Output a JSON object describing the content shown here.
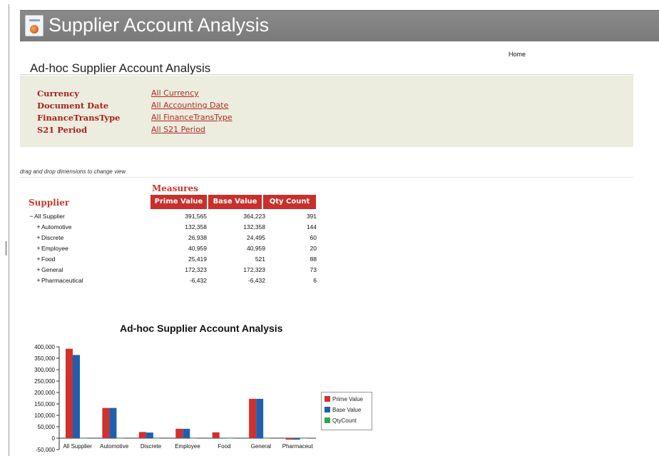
{
  "app": {
    "title": "Supplier Account Analysis"
  },
  "nav": {
    "home_label": "Home"
  },
  "page": {
    "heading": "Ad-hoc Supplier Account Analysis"
  },
  "filters": [
    {
      "label": "Currency",
      "value": "All Currency"
    },
    {
      "label": "Document Date",
      "value": "All Accounting Date"
    },
    {
      "label": "FinanceTransType",
      "value": "All FinanceTransType"
    },
    {
      "label": "S21 Period",
      "value": "All S21 Period"
    }
  ],
  "hint_text": "drag and drop dimensions to change view",
  "grid": {
    "measures_label": "Measures",
    "dimension_label": "Supplier",
    "columns": [
      "Prime Value",
      "Base Value",
      "Qty Count"
    ],
    "rows": [
      {
        "expander": "−",
        "label": "All Supplier",
        "level": 0,
        "values": [
          "391,565",
          "364,223",
          "391"
        ]
      },
      {
        "expander": "+",
        "label": "Automotive",
        "level": 1,
        "values": [
          "132,358",
          "132,358",
          "144"
        ]
      },
      {
        "expander": "+",
        "label": "Discrete",
        "level": 1,
        "values": [
          "26,938",
          "24,495",
          "60"
        ]
      },
      {
        "expander": "+",
        "label": "Employee",
        "level": 1,
        "values": [
          "40,959",
          "40,959",
          "20"
        ]
      },
      {
        "expander": "+",
        "label": "Food",
        "level": 1,
        "values": [
          "25,419",
          "521",
          "88"
        ]
      },
      {
        "expander": "+",
        "label": "General",
        "level": 1,
        "values": [
          "172,323",
          "172,323",
          "73"
        ]
      },
      {
        "expander": "+",
        "label": "Pharmaceutical",
        "level": 1,
        "values": [
          "-6,432",
          "-6,432",
          "6"
        ]
      }
    ]
  },
  "chart_data": {
    "type": "bar",
    "title": "Ad-hoc Supplier Account Analysis",
    "categories": [
      "All Supplier",
      "Automotive",
      "Discrete",
      "Employee",
      "Food",
      "General",
      "Pharmaceut"
    ],
    "series": [
      {
        "name": "Prime Value",
        "color": "#d0312d",
        "values": [
          391565,
          132358,
          26938,
          40959,
          25419,
          172323,
          -6432
        ]
      },
      {
        "name": "Base Value",
        "color": "#1f5fae",
        "values": [
          364223,
          132358,
          24495,
          40959,
          521,
          172323,
          -6432
        ]
      },
      {
        "name": "QtyCount",
        "color": "#2ea84a",
        "values": [
          391,
          144,
          60,
          20,
          88,
          73,
          6
        ]
      }
    ],
    "ylim": [
      -50000,
      400000
    ],
    "yticks": [
      400000,
      350000,
      300000,
      250000,
      200000,
      150000,
      100000,
      50000,
      0,
      -50000
    ],
    "ytick_labels": [
      "400,000",
      "350,000",
      "300,000",
      "250,000",
      "200,000",
      "150,000",
      "100,000",
      "50,000",
      "0",
      "-50,000"
    ],
    "xlabel": "",
    "ylabel": "",
    "legend_position": "right"
  }
}
